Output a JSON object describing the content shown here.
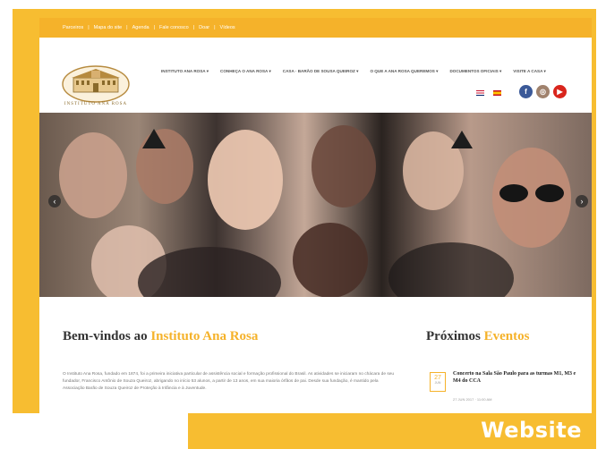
{
  "caption": "Website",
  "topbar": {
    "links": [
      "Parceiros",
      "Mapa do site",
      "Agenda",
      "Fale conosco",
      "Doar",
      "Vídeos"
    ]
  },
  "header": {
    "logo_text": "INSTITUTO ANA ROSA",
    "nav": [
      "INSTITUTO ANA ROSA ▾",
      "CONHEÇA O ANA ROSA ▾",
      "CASA · BARÃO DE SOUSA QUEIROZ ▾",
      "O QUE A ANA ROSA QUEREMOS ▾",
      "DOCUMENTOS OFICIAIS ▾",
      "VISITE A CASA ▾"
    ],
    "socials": [
      {
        "icon": "facebook-icon",
        "glyph": "f"
      },
      {
        "icon": "instagram-icon",
        "glyph": "◎"
      },
      {
        "icon": "youtube-icon",
        "glyph": "▶"
      }
    ]
  },
  "hero": {
    "prev": "‹",
    "next": "›"
  },
  "welcome": {
    "title_prefix": "Bem-vindos ao ",
    "title_accent": "Instituto Ana Rosa",
    "text": "O Instituto Ana Rosa, fundado em 1874, foi a primeira iniciativa particular de assistência social e formação profissional do Brasil. As atividades se iniciaram no chácara de seu fundador, Francisco Antônio de Souza Queiroz, abrigando no início 53 alunos, a partir de 13 anos, em sua maioria órfãos de pai. Desde sua fundação, é mantido pela Associação Barão de Souza Queiroz de Proteção à Infância e à Juventude."
  },
  "events": {
    "title_prefix": "Próximos ",
    "title_accent": "Eventos",
    "items": [
      {
        "day": "27",
        "month": "JUN",
        "title": "Concerto na Sala São Paulo para as turmas M1, M3 e M4 do CCA",
        "meta": "27 JUN 2017 · 11:00 AM"
      }
    ]
  },
  "colors": {
    "accent": "#f7bd31",
    "topbar": "#f5b22a",
    "facebook": "#3b5998",
    "youtube": "#d9251d"
  }
}
